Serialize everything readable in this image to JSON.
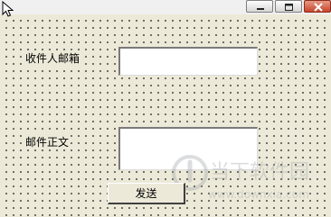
{
  "form": {
    "recipient_label": "收件人邮箱",
    "recipient_value": "",
    "body_label": "邮件正文",
    "body_value": "",
    "send_label": "发送"
  },
  "watermark": {
    "brand": "当下软件园",
    "url": "www.downxia.com"
  },
  "colors": {
    "dialog_bg": "#ece9d8",
    "close_button": "#c7442c"
  },
  "icons": [
    "mouse-cursor-icon",
    "minimize-icon",
    "maximize-icon",
    "close-icon"
  ]
}
